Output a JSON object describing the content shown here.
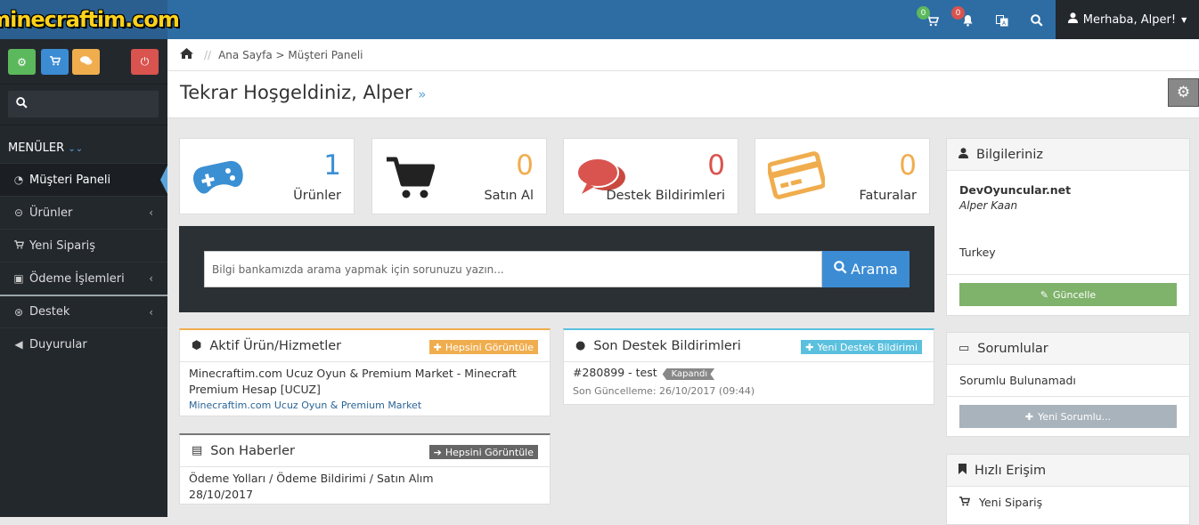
{
  "header": {
    "logo_text": "minecraftim.com",
    "cart_count": "0",
    "notif_count": "0",
    "user_label": "Merhaba, Alper!"
  },
  "sidebar": {
    "menu_title": "MENÜLER",
    "items": [
      {
        "label": "Müşteri Paneli",
        "icon": "dashboard-icon",
        "active": true
      },
      {
        "label": "Ürünler",
        "icon": "gamepad-icon"
      },
      {
        "label": "Yeni Sipariş",
        "icon": "cart-icon"
      },
      {
        "label": "Ödeme İşlemleri",
        "icon": "money-icon"
      },
      {
        "label": "Destek",
        "icon": "lifebuoy-icon"
      },
      {
        "label": "Duyurular",
        "icon": "bullhorn-icon"
      }
    ]
  },
  "breadcrumb": {
    "separator": "//",
    "path": "Ana Sayfa > Müşteri Paneli"
  },
  "page_title": "Tekrar Hoşgeldiniz, Alper",
  "page_title_mark": "»",
  "stats": [
    {
      "value": "1",
      "label": "Ürünler",
      "color": "#3b8fd3"
    },
    {
      "value": "0",
      "label": "Satın Al",
      "color": "#f0ad4e"
    },
    {
      "value": "0",
      "label": "Destek Bildirimleri",
      "color": "#d9534f"
    },
    {
      "value": "0",
      "label": "Faturalar",
      "color": "#f0ad4e"
    }
  ],
  "kb_search": {
    "placeholder": "Bilgi bankamızda arama yapmak için sorunuzu yazın...",
    "button": "Arama"
  },
  "active_products": {
    "title": "Aktif Ürün/Hizmetler",
    "button": "Hepsini Görüntüle",
    "item_title": "Minecraftim.com Ucuz Oyun & Premium Market - Minecraft Premium Hesap [UCUZ]",
    "item_link": "Minecraftim.com Ucuz Oyun & Premium Market"
  },
  "tickets": {
    "title": "Son Destek Bildirimleri",
    "button": "Yeni Destek Bildirimi",
    "ticket": "#280899 - test",
    "status": "Kapandı",
    "updated": "Son Güncelleme: 26/10/2017 (09:44)"
  },
  "news": {
    "title": "Son Haberler",
    "button": "Hepsini Görüntüle",
    "item_title": "Ödeme Yolları / Ödeme Bildirimi / Satın Alım",
    "item_date": "28/10/2017"
  },
  "info": {
    "title": "Bilgileriniz",
    "company": "DevOyuncular.net",
    "name": "Alper Kaan",
    "country": "Turkey",
    "button": "Güncelle"
  },
  "contacts": {
    "title": "Sorumlular",
    "empty": "Sorumlu Bulunamadı",
    "button": "Yeni Sorumlu..."
  },
  "quick": {
    "title": "Hızlı Erişim",
    "item": "Yeni Sipariş"
  }
}
